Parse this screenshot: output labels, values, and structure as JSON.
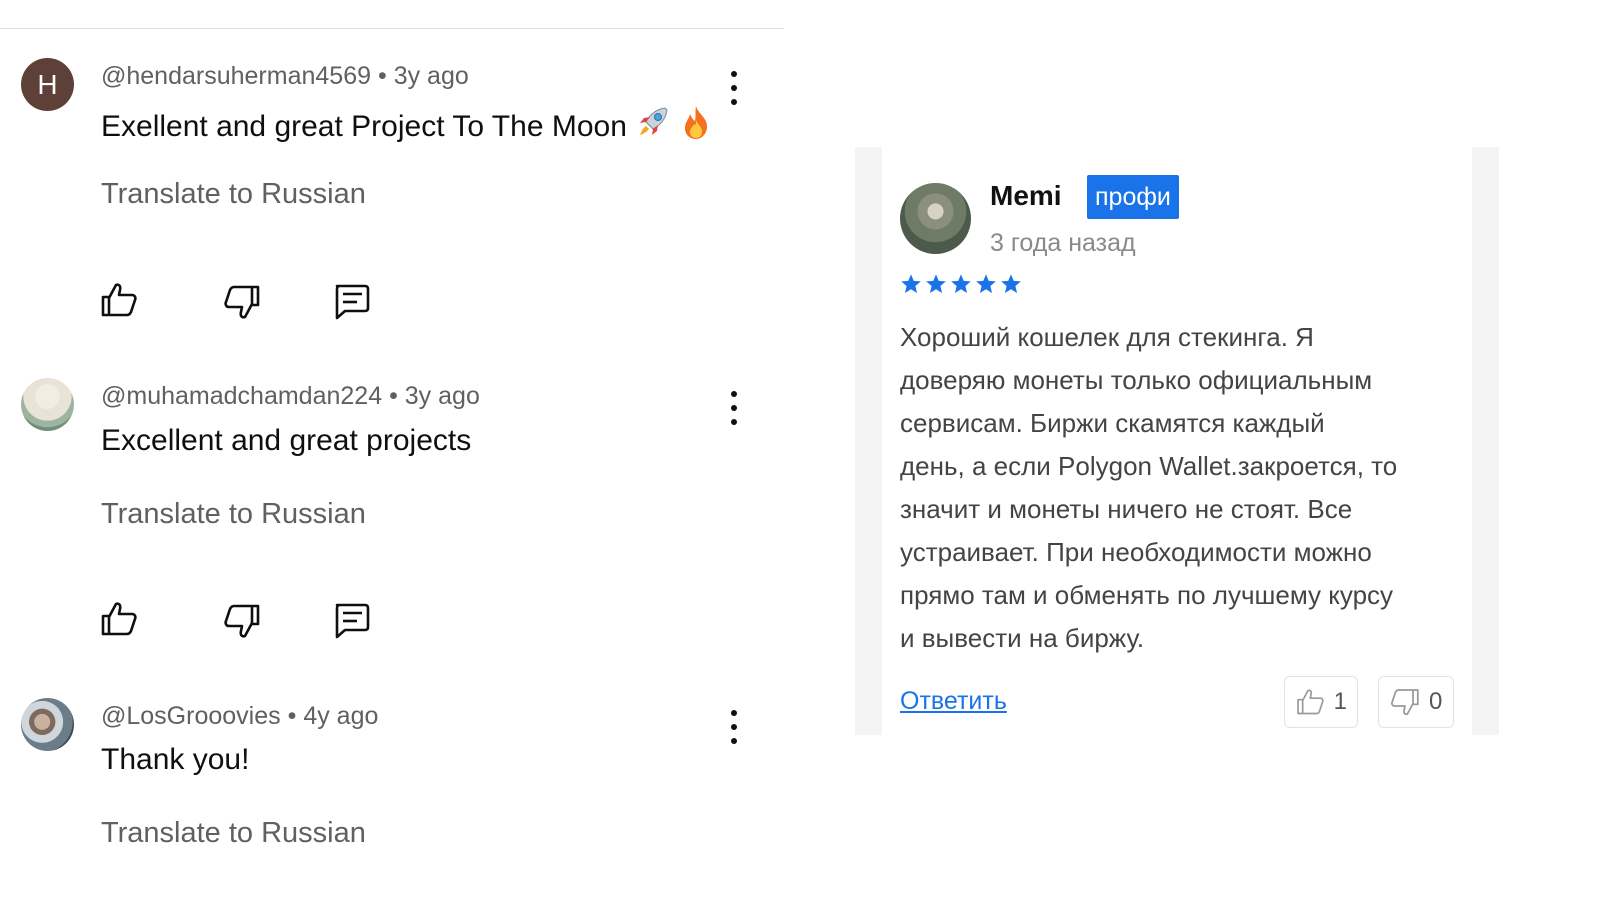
{
  "comments": [
    {
      "avatar_letter": "H",
      "handle": "@hendarsuherman4569",
      "separator": "•",
      "age": "3y ago",
      "text": "Exellent and great Project To The Moon",
      "emojis": [
        "rocket",
        "fire"
      ],
      "translate_label": "Translate to Russian"
    },
    {
      "avatar_letter": "",
      "handle": "@muhamadchamdan224",
      "separator": "•",
      "age": "3y ago",
      "text": "Excellent and great projects",
      "emojis": [],
      "translate_label": "Translate to Russian"
    },
    {
      "avatar_letter": "",
      "handle": "@LosGrooovies",
      "separator": "•",
      "age": "4y ago",
      "text": "Thank you!",
      "emojis": [],
      "translate_label": "Translate to Russian"
    }
  ],
  "comment_actions": [
    "thumbs-up-icon",
    "thumbs-down-icon",
    "reply-comment-icon"
  ],
  "review": {
    "author": "Memi",
    "badge": "профи",
    "date": "3 года назад",
    "rating": 5,
    "rating_max": 5,
    "body_lines": [
      "Хороший кошелек для стекинга. Я",
      "доверяю монеты только официальным",
      "сервисам. Биржи скамятся каждый",
      "день, а если Polygon Wallet.закроется, то",
      "значит и монеты ничего не стоят. Все",
      "устраивает. При необходимости можно",
      "прямо там и обменять по лучшему курсу",
      "и вывести на биржу."
    ],
    "reply_label": "Ответить",
    "likes": "1",
    "dislikes": "0"
  },
  "colors": {
    "meta_text": "#606060",
    "primary_text": "#0f0f0f",
    "badge_blue": "#1a73e8",
    "star_blue": "#1a73e8",
    "avatar_letter_bg": "#5d4037"
  }
}
